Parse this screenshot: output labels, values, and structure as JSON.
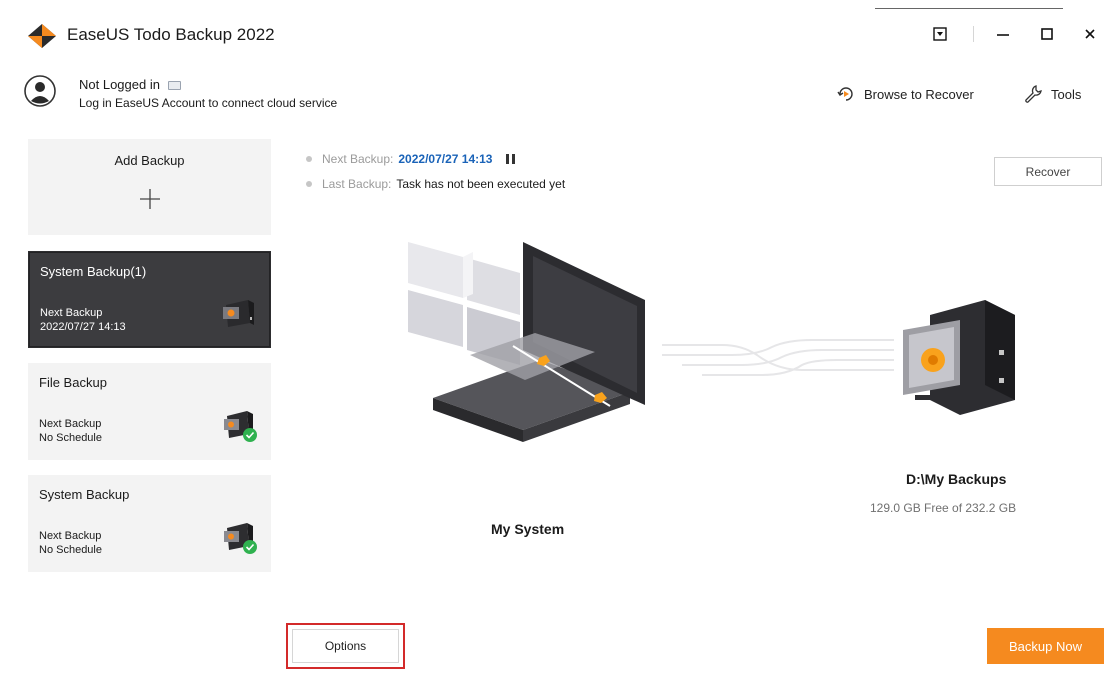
{
  "app": {
    "title": "EaseUS Todo Backup 2022",
    "brand_color": "#f58a1f"
  },
  "window_controls": [
    "dropdown-icon",
    "minimize-icon",
    "maximize-icon",
    "close-icon"
  ],
  "account": {
    "name": "Not Logged in",
    "subtitle": "Log in EaseUS Account to connect cloud service"
  },
  "top_actions": {
    "browse_to_recover": "Browse to Recover",
    "tools": "Tools"
  },
  "sidebar": {
    "add_backup": "Add Backup",
    "cards": [
      {
        "title": "System Backup(1)",
        "line1": "Next Backup",
        "line2": "2022/07/27 14:13",
        "selected": true
      },
      {
        "title": "File Backup",
        "line1": "Next Backup",
        "line2": "No Schedule",
        "selected": false
      },
      {
        "title": "System Backup",
        "line1": "Next Backup",
        "line2": "No Schedule",
        "selected": false
      }
    ]
  },
  "main": {
    "next_backup_label": "Next Backup:",
    "next_backup_value": "2022/07/27 14:13",
    "last_backup_label": "Last Backup:",
    "last_backup_value": "Task has not been executed yet",
    "recover_button": "Recover",
    "source_label": "My System",
    "destination_label": "D:\\My Backups",
    "destination_space": "129.0 GB Free of 232.2 GB",
    "options_button": "Options",
    "backup_now_button": "Backup Now"
  }
}
